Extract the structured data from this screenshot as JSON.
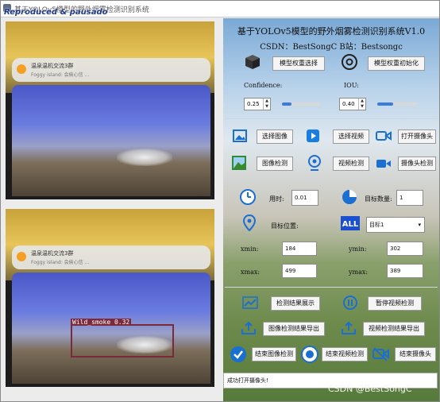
{
  "window": {
    "title": "基于YOLOv5模型的野外烟雾检测识别系统",
    "watermark": "Reproduced & pausado"
  },
  "video": {
    "notif_line1": "温泉温机交流3群",
    "notif_line2": "Foggy island: 会偷心信 ...",
    "detection_label": "Wild_smoke 0.32"
  },
  "header": {
    "title": "基于YOLOv5模型的野外烟雾检测识别系统V1.0",
    "subtitle": "CSDN：BestSongC  B站：Bestsongc"
  },
  "model": {
    "select_label": "模型权重选择",
    "init_label": "模型权重初始化"
  },
  "params": {
    "confidence_label": "Confidence:",
    "confidence_value": "0.25",
    "confidence_fill": 0.25,
    "iou_label": "IOU:",
    "iou_value": "0.40",
    "iou_fill": 0.4
  },
  "actions": {
    "select_image": "选择图像",
    "select_video": "选择视频",
    "open_camera": "打开摄像头",
    "image_detect": "图像检测",
    "video_detect": "视频检测",
    "camera_detect": "摄像头检测"
  },
  "stats": {
    "time_label": "用时:",
    "time_value": "0.01",
    "count_label": "目标数量:",
    "count_value": "1",
    "pos_label": "目标位置:",
    "target_select": "目标1",
    "xmin_label": "xmin:",
    "xmin_value": "184",
    "ymin_label": "ymin:",
    "ymin_value": "302",
    "xmax_label": "xmax:",
    "xmax_value": "499",
    "ymax_label": "ymax:",
    "ymax_value": "389"
  },
  "results": {
    "show": "检测结果展示",
    "pause": "暂停视频检测",
    "export_image": "图像检测结果导出",
    "export_video": "视频检测结果导出",
    "end_image": "结束图像检测",
    "end_video": "结束视频检测",
    "end_camera": "结束摄像头"
  },
  "status": {
    "text": "成功打开摄像头!"
  },
  "credit": "CSDN @BestSongC"
}
